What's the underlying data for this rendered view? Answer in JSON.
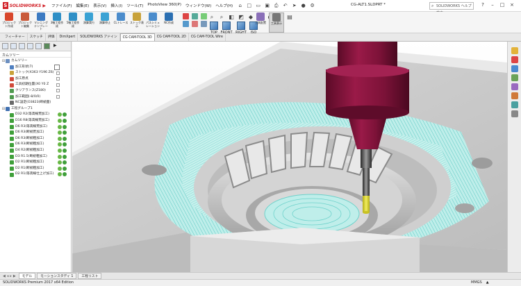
{
  "app": {
    "brand": "SOLIDWORKS",
    "document_title": "CG-ALT1.SLDPRT *",
    "help_search_placeholder": "SOLIDWORKS ヘルプ検索",
    "menus": [
      "ファイル(F)",
      "編集(E)",
      "表示(V)",
      "挿入(I)",
      "ツール(T)",
      "PhotoView 360(P)",
      "ウィンドウ(W)",
      "ヘルプ(H)"
    ]
  },
  "command_manager": {
    "buttons": [
      {
        "label": "プロジェクト作成",
        "color": "#d8472c"
      },
      {
        "label": "プロジェクト編集",
        "color": "#d8472c"
      },
      {
        "label": "マシニングテンプレート",
        "color": "#3c7ac2"
      },
      {
        "label": "3軸工程作成",
        "color": "#2f8fc6"
      },
      {
        "label": "5軸工程作成",
        "color": "#2f8fc6"
      },
      {
        "label": "演算実行",
        "color": "#3aa2d4"
      },
      {
        "label": "演算停止",
        "color": "#3aa2d4"
      },
      {
        "label": "CLトレース",
        "color": "#4b8ccc"
      },
      {
        "label": "ストック表示",
        "color": "#4b8ccc"
      },
      {
        "label": "パスシミュレーション",
        "color": "#4b8ccc"
      },
      {
        "label": "NC作成",
        "color": "#2b6fb2"
      },
      {
        "label": "工程リスト",
        "color": "#2b6fb2"
      }
    ],
    "views": [
      "TOP",
      "FRONT",
      "RIGHT",
      "ISO"
    ],
    "end_buttons": [
      {
        "label": "工具配置",
        "color": "#8a6fb8"
      },
      {
        "label": "工具表示",
        "color": "#777777"
      }
    ]
  },
  "tabs": [
    "フィーチャー",
    "スケッチ",
    "評価",
    "DimXpert",
    "SOLIDWORKS アドイン",
    "CG CAM-TOOL 3D",
    "CG CAM-TOOL 2D",
    "CG CAM-TOOL Wire"
  ],
  "active_tab": "CG CAM-TOOL 3D",
  "tree": {
    "header": "カムツリー",
    "root": "カムツリー",
    "setup_items": [
      {
        "label": "加工形状(7)",
        "color": "#4f7fc0"
      },
      {
        "label": "ストック(X363 Y196 Z6)",
        "color": "#c8a23a"
      },
      {
        "label": "加工原点",
        "color": "#d04a3a"
      },
      {
        "label": "工具初期位置(X0 Y0 Z",
        "color": "#d04a3a"
      },
      {
        "label": "クリアランス(Z180)",
        "color": "#4f9a4f"
      },
      {
        "label": "加工範囲(-8/0/0)",
        "color": "#4f9a4f"
      },
      {
        "label": "NC設定(O3823(断続面)",
        "color": "#6a6a6a"
      }
    ],
    "group_label": "工程グループ1",
    "processes": [
      "D32 R2(等高線荒加工)",
      "D16 R8(等高線荒加工)",
      "D6 R3(等高線荒加工)",
      "D6 R3(断続荒加工)",
      "D6 R3(断続粗加工)",
      "D6 R3(断続粗加工)",
      "D4 R2(断続粗加工)",
      "D3 R1.5(断続粗加工)",
      "D2 R1(断続粗加工)",
      "D2 R1(断続粗加工)",
      "D2 R1(等高線仕上げ加工)"
    ]
  },
  "bottom_tabs": [
    "モデル",
    "モーションスタディ 1",
    "工程リスト"
  ],
  "status": {
    "edition": "SOLIDWORKS Premium 2017 x64 Edition",
    "units": "MMGS"
  },
  "colors": {
    "tool_holder": "#84123c",
    "tool_tip": "#e3dd3a",
    "toolpath": "#7fd9d4",
    "part_metal": "#c7c7c7"
  }
}
